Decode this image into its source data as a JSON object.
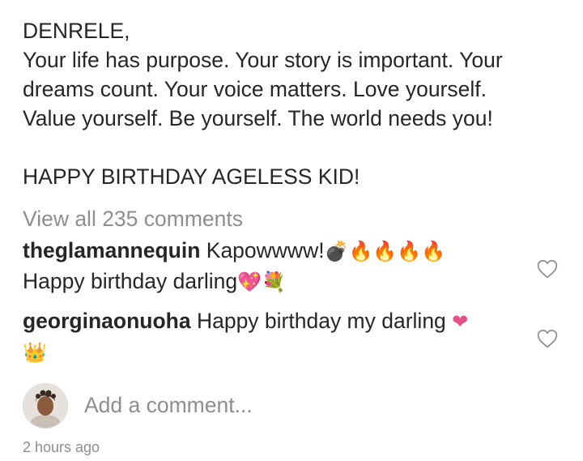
{
  "caption": {
    "lines": [
      "DENRELE,",
      "Your life has purpose. Your story is important. Your",
      "dreams count. Your voice matters. Love yourself.",
      "Value yourself. Be yourself. The world needs you!",
      "HAPPY BIRTHDAY AGELESS KID!"
    ]
  },
  "view_all": "View all 235 comments",
  "comments": [
    {
      "username": "theglamannequin",
      "text": "Kapowwww!",
      "emoji_line1": "💣🔥🔥🔥🔥",
      "text2": "Happy birthday darling",
      "emoji_line2": "💖💐"
    },
    {
      "username": "georginaonuoha",
      "text": "Happy birthday my darling",
      "emoji_line1": "❤",
      "emoji_line2": "👑"
    }
  ],
  "add_comment": {
    "placeholder": "Add a comment..."
  },
  "timestamp": "2 hours ago",
  "colors": {
    "text": "#262626",
    "muted": "#8e8e8e",
    "heart": "#e8508a"
  }
}
